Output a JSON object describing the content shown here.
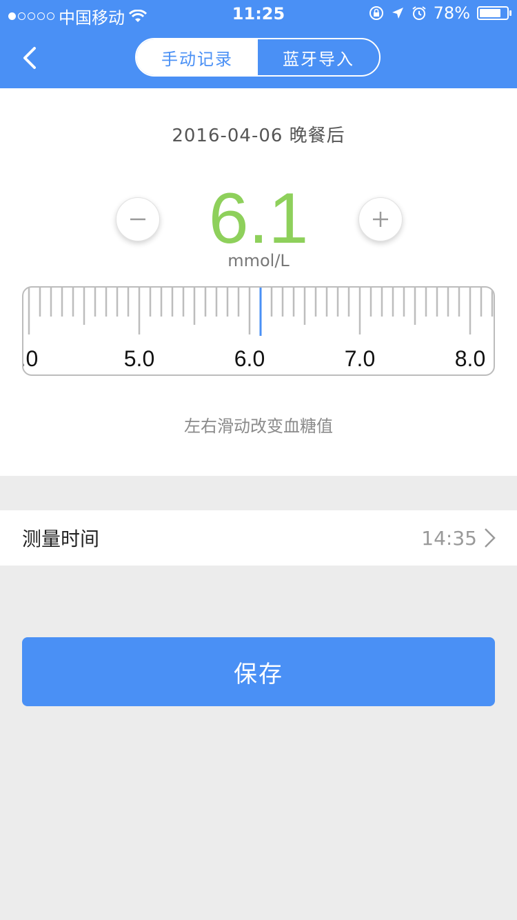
{
  "status_bar": {
    "carrier": "中国移动",
    "time": "11:25",
    "battery": "78%",
    "battery_level": 0.78
  },
  "header": {
    "tabs": [
      {
        "label": "手动记录",
        "active": true
      },
      {
        "label": "蓝牙导入",
        "active": false
      }
    ]
  },
  "reading": {
    "date_meal": "2016-04-06  晚餐后",
    "value": "6.1",
    "unit": "mmol/L",
    "value_color": "#8ed05b"
  },
  "ruler": {
    "labels": [
      ".0",
      "5.0",
      "6.0",
      "7.0",
      "8.0"
    ],
    "current": 6.1
  },
  "hint": "左右滑动改变血糖值",
  "measure_time": {
    "label": "测量时间",
    "value": "14:35"
  },
  "save_label": "保存",
  "colors": {
    "accent": "#4a90f5",
    "value_green": "#8ed05b",
    "background": "#ececec"
  }
}
